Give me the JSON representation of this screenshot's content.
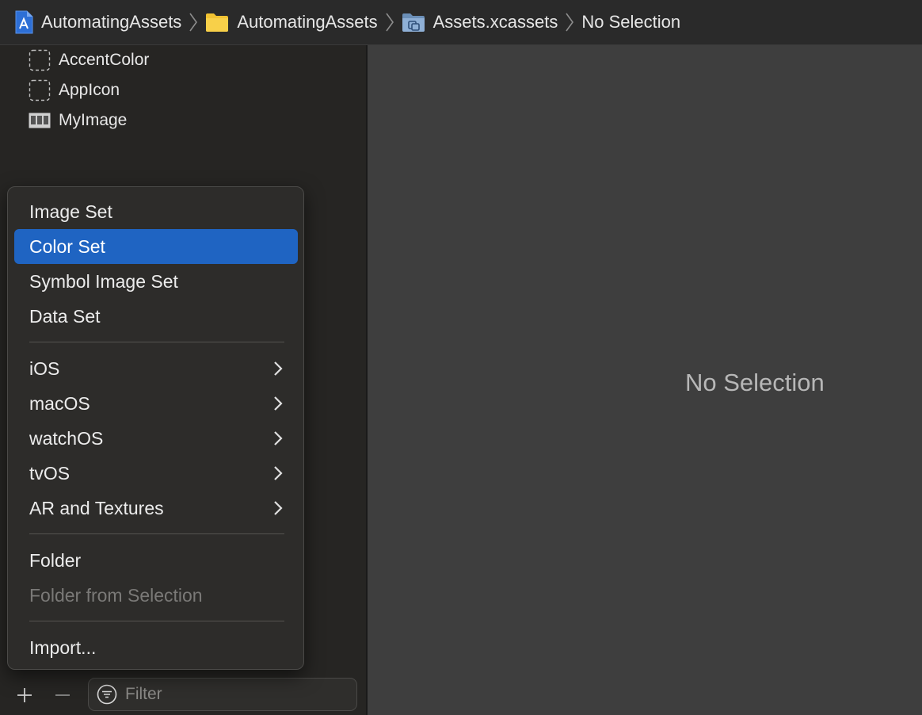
{
  "breadcrumb": [
    {
      "label": "AutomatingAssets",
      "icon": "xcode-project-icon"
    },
    {
      "label": "AutomatingAssets",
      "icon": "folder-icon"
    },
    {
      "label": "Assets.xcassets",
      "icon": "asset-catalog-icon"
    },
    {
      "label": "No Selection",
      "icon": ""
    }
  ],
  "sidebar": {
    "assets": [
      {
        "label": "AccentColor",
        "icon": "color-set-placeholder-icon"
      },
      {
        "label": "AppIcon",
        "icon": "app-icon-placeholder-icon"
      },
      {
        "label": "MyImage",
        "icon": "image-set-icon"
      }
    ]
  },
  "menu": {
    "items": [
      {
        "label": "Image Set",
        "state": "normal"
      },
      {
        "label": "Color Set",
        "state": "highlighted"
      },
      {
        "label": "Symbol Image Set",
        "state": "normal"
      },
      {
        "label": "Data Set",
        "state": "normal"
      },
      {
        "label": "iOS",
        "state": "normal",
        "submenu": true
      },
      {
        "label": "macOS",
        "state": "normal",
        "submenu": true
      },
      {
        "label": "watchOS",
        "state": "normal",
        "submenu": true
      },
      {
        "label": "tvOS",
        "state": "normal",
        "submenu": true
      },
      {
        "label": "AR and Textures",
        "state": "normal",
        "submenu": true
      },
      {
        "label": "Folder",
        "state": "normal"
      },
      {
        "label": "Folder from Selection",
        "state": "disabled"
      },
      {
        "label": "Import...",
        "state": "normal"
      }
    ]
  },
  "bottombar": {
    "add_icon": "plus-icon",
    "remove_icon": "minus-icon",
    "filter_placeholder": "Filter"
  },
  "main": {
    "empty_label": "No Selection"
  },
  "colors": {
    "highlight": "#1f64c2",
    "sidebar_bg": "#262523",
    "main_bg": "#3e3e3e",
    "menu_bg": "#2d2c2a"
  }
}
